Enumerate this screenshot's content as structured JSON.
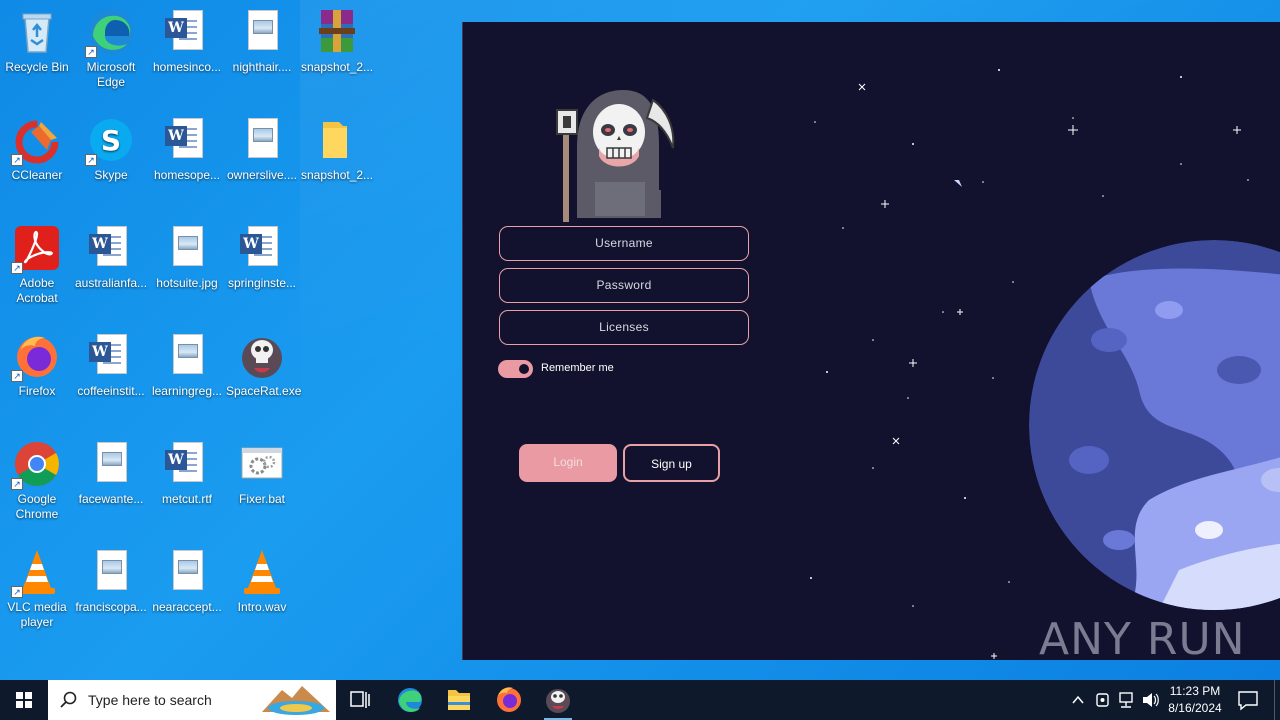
{
  "desktop": {
    "icons": [
      {
        "label": "Recycle Bin",
        "icon": "recycle-bin-icon"
      },
      {
        "label": "Microsoft Edge",
        "icon": "edge-icon"
      },
      {
        "label": "homesinco...",
        "icon": "word-doc-icon"
      },
      {
        "label": "nighthair....",
        "icon": "image-file-icon"
      },
      {
        "label": "snapshot_2...",
        "icon": "winrar-icon"
      },
      {
        "label": "CCleaner",
        "icon": "ccleaner-icon"
      },
      {
        "label": "Skype",
        "icon": "skype-icon"
      },
      {
        "label": "homesope...",
        "icon": "word-doc-icon"
      },
      {
        "label": "ownerslive....",
        "icon": "image-file-icon"
      },
      {
        "label": "snapshot_2...",
        "icon": "folder-icon"
      },
      {
        "label": "Adobe Acrobat",
        "icon": "acrobat-icon"
      },
      {
        "label": "australianfa...",
        "icon": "word-doc-icon"
      },
      {
        "label": "hotsuite.jpg",
        "icon": "image-file-icon"
      },
      {
        "label": "springinste...",
        "icon": "word-doc-icon"
      },
      {
        "label": "Firefox",
        "icon": "firefox-icon"
      },
      {
        "label": "coffeeinstit...",
        "icon": "word-doc-icon"
      },
      {
        "label": "learningreg...",
        "icon": "image-file-icon"
      },
      {
        "label": "SpaceRat.exe",
        "icon": "skull-app-icon"
      },
      {
        "label": "Google Chrome",
        "icon": "chrome-icon"
      },
      {
        "label": "facewante...",
        "icon": "image-file-icon"
      },
      {
        "label": "metcut.rtf",
        "icon": "word-doc-icon"
      },
      {
        "label": "Fixer.bat",
        "icon": "batch-file-icon"
      },
      {
        "label": "VLC media player",
        "icon": "vlc-icon"
      },
      {
        "label": "franciscopa...",
        "icon": "image-file-icon"
      },
      {
        "label": "nearaccept...",
        "icon": "image-file-icon"
      },
      {
        "label": "Intro.wav",
        "icon": "vlc-icon"
      }
    ]
  },
  "login_window": {
    "fields": {
      "username": "Username",
      "password": "Password",
      "licenses": "Licenses"
    },
    "remember_me": {
      "label": "Remember me",
      "checked": true
    },
    "login_label": "Login",
    "signup_label": "Sign up",
    "watermark": "ANY RUN",
    "colors": {
      "background": "#12122e",
      "accent": "#e99aa2"
    }
  },
  "taskbar": {
    "search_placeholder": "Type here to search",
    "apps": [
      "task-view-icon",
      "edge-icon",
      "file-explorer-icon",
      "firefox-icon",
      "spacerat-icon"
    ],
    "clock": {
      "time": "11:23 PM",
      "date": "8/16/2024"
    }
  }
}
